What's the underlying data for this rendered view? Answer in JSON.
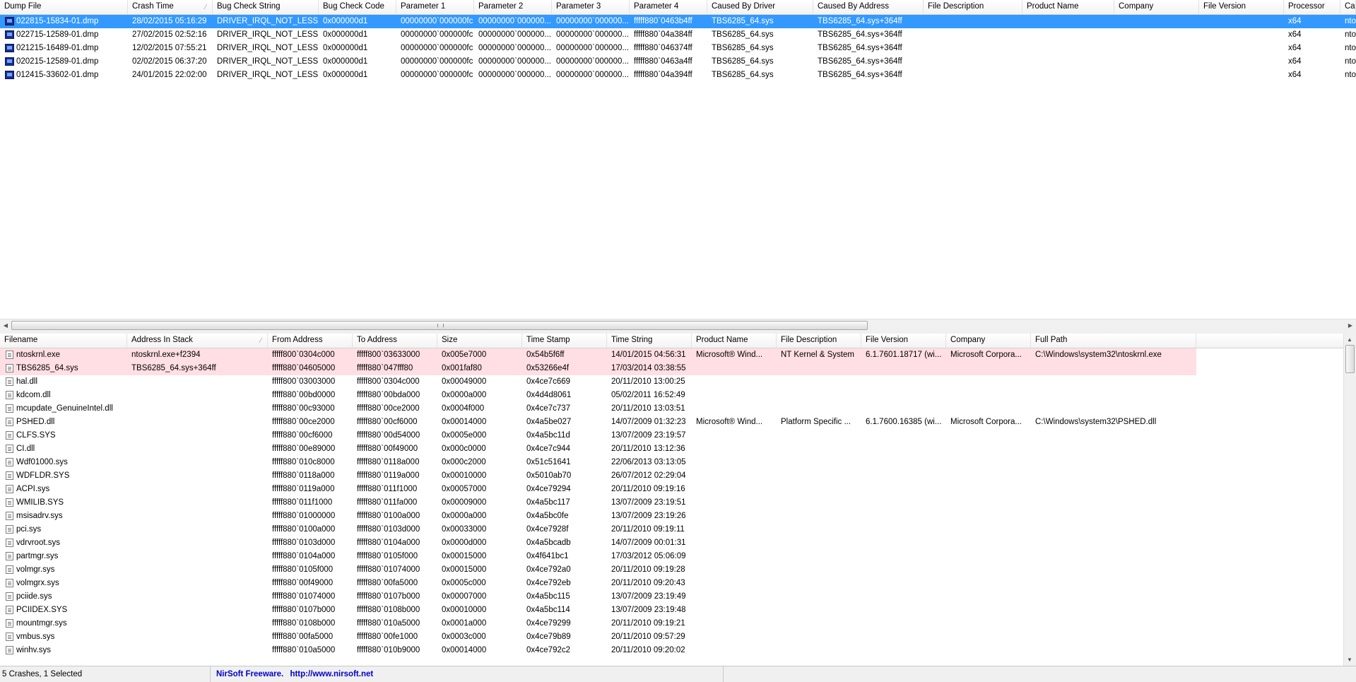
{
  "top_table": {
    "columns": [
      "Dump File",
      "Crash Time",
      "Bug Check String",
      "Bug Check Code",
      "Parameter 1",
      "Parameter 2",
      "Parameter 3",
      "Parameter 4",
      "Caused By Driver",
      "Caused By Address",
      "File Description",
      "Product Name",
      "Company",
      "File Version",
      "Processor",
      "Ca"
    ],
    "sort_column": "Crash Time",
    "rows": [
      {
        "selected": true,
        "cells": [
          "022815-15834-01.dmp",
          "28/02/2015 05:16:29",
          "DRIVER_IRQL_NOT_LESS...",
          "0x000000d1",
          "00000000`000000fc",
          "00000000`000000...",
          "00000000`000000...",
          "fffff880`0463b4ff",
          "TBS6285_64.sys",
          "TBS6285_64.sys+364ff",
          "",
          "",
          "",
          "",
          "x64",
          "nto"
        ]
      },
      {
        "selected": false,
        "cells": [
          "022715-12589-01.dmp",
          "27/02/2015 02:52:16",
          "DRIVER_IRQL_NOT_LESS...",
          "0x000000d1",
          "00000000`000000fc",
          "00000000`000000...",
          "00000000`000000...",
          "fffff880`04a384ff",
          "TBS6285_64.sys",
          "TBS6285_64.sys+364ff",
          "",
          "",
          "",
          "",
          "x64",
          "nto"
        ]
      },
      {
        "selected": false,
        "cells": [
          "021215-16489-01.dmp",
          "12/02/2015 07:55:21",
          "DRIVER_IRQL_NOT_LESS...",
          "0x000000d1",
          "00000000`000000fc",
          "00000000`000000...",
          "00000000`000000...",
          "fffff880`046374ff",
          "TBS6285_64.sys",
          "TBS6285_64.sys+364ff",
          "",
          "",
          "",
          "",
          "x64",
          "nto"
        ]
      },
      {
        "selected": false,
        "cells": [
          "020215-12589-01.dmp",
          "02/02/2015 06:37:20",
          "DRIVER_IRQL_NOT_LESS...",
          "0x000000d1",
          "00000000`000000fc",
          "00000000`000000...",
          "00000000`000000...",
          "fffff880`0463a4ff",
          "TBS6285_64.sys",
          "TBS6285_64.sys+364ff",
          "",
          "",
          "",
          "",
          "x64",
          "nto"
        ]
      },
      {
        "selected": false,
        "cells": [
          "012415-33602-01.dmp",
          "24/01/2015 22:02:00",
          "DRIVER_IRQL_NOT_LESS...",
          "0x000000d1",
          "00000000`000000fc",
          "00000000`000000...",
          "00000000`000000...",
          "fffff880`04a394ff",
          "TBS6285_64.sys",
          "TBS6285_64.sys+364ff",
          "",
          "",
          "",
          "",
          "x64",
          "nto"
        ]
      }
    ]
  },
  "bottom_table": {
    "columns": [
      "Filename",
      "Address In Stack",
      "From Address",
      "To Address",
      "Size",
      "Time Stamp",
      "Time String",
      "Product Name",
      "File Description",
      "File Version",
      "Company",
      "Full Path"
    ],
    "sort_column": "Address In Stack",
    "rows": [
      {
        "highlight": true,
        "cells": [
          "ntoskrnl.exe",
          "ntoskrnl.exe+f2394",
          "fffff800`0304c000",
          "fffff800`03633000",
          "0x005e7000",
          "0x54b5f6ff",
          "14/01/2015 04:56:31",
          "Microsoft® Wind...",
          "NT Kernel & System",
          "6.1.7601.18717 (wi...",
          "Microsoft Corpora...",
          "C:\\Windows\\system32\\ntoskrnl.exe"
        ]
      },
      {
        "highlight": true,
        "cells": [
          "TBS6285_64.sys",
          "TBS6285_64.sys+364ff",
          "fffff880`04605000",
          "fffff880`047fff80",
          "0x001faf80",
          "0x53266e4f",
          "17/03/2014 03:38:55",
          "",
          "",
          "",
          "",
          ""
        ]
      },
      {
        "highlight": false,
        "cells": [
          "hal.dll",
          "",
          "fffff800`03003000",
          "fffff800`0304c000",
          "0x00049000",
          "0x4ce7c669",
          "20/11/2010 13:00:25",
          "",
          "",
          "",
          "",
          ""
        ]
      },
      {
        "highlight": false,
        "cells": [
          "kdcom.dll",
          "",
          "fffff880`00bd0000",
          "fffff880`00bda000",
          "0x0000a000",
          "0x4d4d8061",
          "05/02/2011 16:52:49",
          "",
          "",
          "",
          "",
          ""
        ]
      },
      {
        "highlight": false,
        "cells": [
          "mcupdate_GenuineIntel.dll",
          "",
          "fffff880`00c93000",
          "fffff880`00ce2000",
          "0x0004f000",
          "0x4ce7c737",
          "20/11/2010 13:03:51",
          "",
          "",
          "",
          "",
          ""
        ]
      },
      {
        "highlight": false,
        "cells": [
          "PSHED.dll",
          "",
          "fffff880`00ce2000",
          "fffff880`00cf6000",
          "0x00014000",
          "0x4a5be027",
          "14/07/2009 01:32:23",
          "Microsoft® Wind...",
          "Platform Specific ...",
          "6.1.7600.16385 (wi...",
          "Microsoft Corpora...",
          "C:\\Windows\\system32\\PSHED.dll"
        ]
      },
      {
        "highlight": false,
        "cells": [
          "CLFS.SYS",
          "",
          "fffff880`00cf6000",
          "fffff880`00d54000",
          "0x0005e000",
          "0x4a5bc11d",
          "13/07/2009 23:19:57",
          "",
          "",
          "",
          "",
          ""
        ]
      },
      {
        "highlight": false,
        "cells": [
          "CI.dll",
          "",
          "fffff880`00e89000",
          "fffff880`00f49000",
          "0x000c0000",
          "0x4ce7c944",
          "20/11/2010 13:12:36",
          "",
          "",
          "",
          "",
          ""
        ]
      },
      {
        "highlight": false,
        "cells": [
          "Wdf01000.sys",
          "",
          "fffff880`010c8000",
          "fffff880`0118a000",
          "0x000c2000",
          "0x51c51641",
          "22/06/2013 03:13:05",
          "",
          "",
          "",
          "",
          ""
        ]
      },
      {
        "highlight": false,
        "cells": [
          "WDFLDR.SYS",
          "",
          "fffff880`0118a000",
          "fffff880`0119a000",
          "0x00010000",
          "0x5010ab70",
          "26/07/2012 02:29:04",
          "",
          "",
          "",
          "",
          ""
        ]
      },
      {
        "highlight": false,
        "cells": [
          "ACPI.sys",
          "",
          "fffff880`0119a000",
          "fffff880`011f1000",
          "0x00057000",
          "0x4ce79294",
          "20/11/2010 09:19:16",
          "",
          "",
          "",
          "",
          ""
        ]
      },
      {
        "highlight": false,
        "cells": [
          "WMILIB.SYS",
          "",
          "fffff880`011f1000",
          "fffff880`011fa000",
          "0x00009000",
          "0x4a5bc117",
          "13/07/2009 23:19:51",
          "",
          "",
          "",
          "",
          ""
        ]
      },
      {
        "highlight": false,
        "cells": [
          "msisadrv.sys",
          "",
          "fffff880`01000000",
          "fffff880`0100a000",
          "0x0000a000",
          "0x4a5bc0fe",
          "13/07/2009 23:19:26",
          "",
          "",
          "",
          "",
          ""
        ]
      },
      {
        "highlight": false,
        "cells": [
          "pci.sys",
          "",
          "fffff880`0100a000",
          "fffff880`0103d000",
          "0x00033000",
          "0x4ce7928f",
          "20/11/2010 09:19:11",
          "",
          "",
          "",
          "",
          ""
        ]
      },
      {
        "highlight": false,
        "cells": [
          "vdrvroot.sys",
          "",
          "fffff880`0103d000",
          "fffff880`0104a000",
          "0x0000d000",
          "0x4a5bcadb",
          "14/07/2009 00:01:31",
          "",
          "",
          "",
          "",
          ""
        ]
      },
      {
        "highlight": false,
        "cells": [
          "partmgr.sys",
          "",
          "fffff880`0104a000",
          "fffff880`0105f000",
          "0x00015000",
          "0x4f641bc1",
          "17/03/2012 05:06:09",
          "",
          "",
          "",
          "",
          ""
        ]
      },
      {
        "highlight": false,
        "cells": [
          "volmgr.sys",
          "",
          "fffff880`0105f000",
          "fffff880`01074000",
          "0x00015000",
          "0x4ce792a0",
          "20/11/2010 09:19:28",
          "",
          "",
          "",
          "",
          ""
        ]
      },
      {
        "highlight": false,
        "cells": [
          "volmgrx.sys",
          "",
          "fffff880`00f49000",
          "fffff880`00fa5000",
          "0x0005c000",
          "0x4ce792eb",
          "20/11/2010 09:20:43",
          "",
          "",
          "",
          "",
          ""
        ]
      },
      {
        "highlight": false,
        "cells": [
          "pciide.sys",
          "",
          "fffff880`01074000",
          "fffff880`0107b000",
          "0x00007000",
          "0x4a5bc115",
          "13/07/2009 23:19:49",
          "",
          "",
          "",
          "",
          ""
        ]
      },
      {
        "highlight": false,
        "cells": [
          "PCIIDEX.SYS",
          "",
          "fffff880`0107b000",
          "fffff880`0108b000",
          "0x00010000",
          "0x4a5bc114",
          "13/07/2009 23:19:48",
          "",
          "",
          "",
          "",
          ""
        ]
      },
      {
        "highlight": false,
        "cells": [
          "mountmgr.sys",
          "",
          "fffff880`0108b000",
          "fffff880`010a5000",
          "0x0001a000",
          "0x4ce79299",
          "20/11/2010 09:19:21",
          "",
          "",
          "",
          "",
          ""
        ]
      },
      {
        "highlight": false,
        "cells": [
          "vmbus.sys",
          "",
          "fffff880`00fa5000",
          "fffff880`00fe1000",
          "0x0003c000",
          "0x4ce79b89",
          "20/11/2010 09:57:29",
          "",
          "",
          "",
          "",
          ""
        ]
      },
      {
        "highlight": false,
        "cells": [
          "winhv.sys",
          "",
          "fffff880`010a5000",
          "fffff880`010b9000",
          "0x00014000",
          "0x4ce792c2",
          "20/11/2010 09:20:02",
          "",
          "",
          "",
          "",
          ""
        ]
      }
    ]
  },
  "status": {
    "count_text": "5 Crashes, 1 Selected",
    "freeware_text": "NirSoft Freeware.",
    "url_text": "http://www.nirsoft.net"
  },
  "colors": {
    "selection": "#3399ff",
    "highlight_row": "#ffdfe3",
    "link": "#0000cc"
  }
}
